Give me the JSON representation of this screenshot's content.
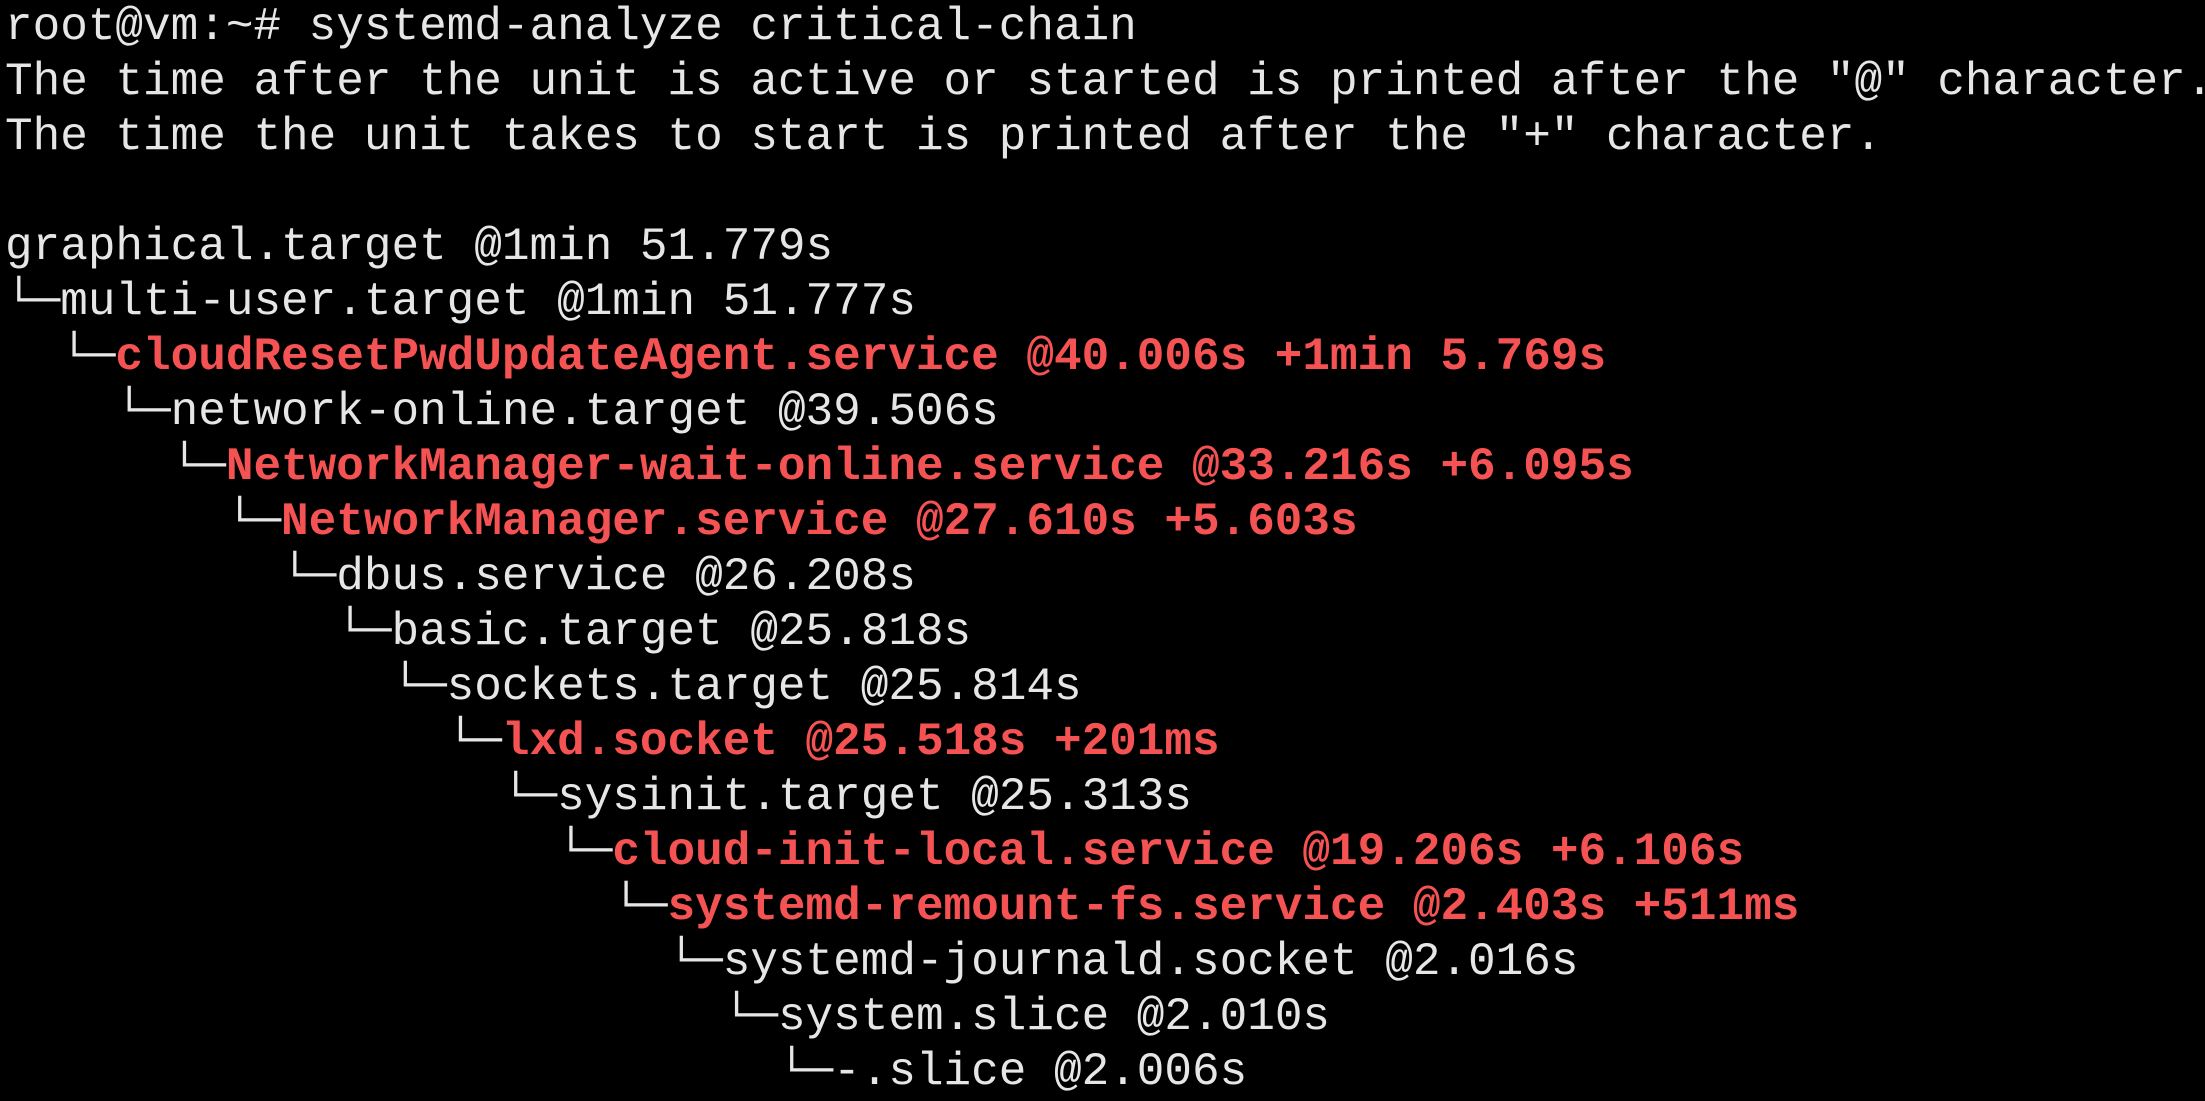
{
  "terminal": {
    "prompt": "root@vm:~# systemd-analyze critical-chain",
    "info_lines": [
      "The time after the unit is active or started is printed after the \"@\" character.",
      "The time the unit takes to start is printed after the \"+\" character."
    ],
    "chain": [
      {
        "prefix": "",
        "text": "graphical.target @1min 51.779s",
        "highlight": false
      },
      {
        "prefix": "└─",
        "text": "multi-user.target @1min 51.777s",
        "highlight": false
      },
      {
        "prefix": "  └─",
        "text": "cloudResetPwdUpdateAgent.service @40.006s +1min 5.769s",
        "highlight": true
      },
      {
        "prefix": "    └─",
        "text": "network-online.target @39.506s",
        "highlight": false
      },
      {
        "prefix": "      └─",
        "text": "NetworkManager-wait-online.service @33.216s +6.095s",
        "highlight": true
      },
      {
        "prefix": "        └─",
        "text": "NetworkManager.service @27.610s +5.603s",
        "highlight": true
      },
      {
        "prefix": "          └─",
        "text": "dbus.service @26.208s",
        "highlight": false
      },
      {
        "prefix": "            └─",
        "text": "basic.target @25.818s",
        "highlight": false
      },
      {
        "prefix": "              └─",
        "text": "sockets.target @25.814s",
        "highlight": false
      },
      {
        "prefix": "                └─",
        "text": "lxd.socket @25.518s +201ms",
        "highlight": true
      },
      {
        "prefix": "                  └─",
        "text": "sysinit.target @25.313s",
        "highlight": false
      },
      {
        "prefix": "                    └─",
        "text": "cloud-init-local.service @19.206s +6.106s",
        "highlight": true
      },
      {
        "prefix": "                      └─",
        "text": "systemd-remount-fs.service @2.403s +511ms",
        "highlight": true
      },
      {
        "prefix": "                        └─",
        "text": "systemd-journald.socket @2.016s",
        "highlight": false
      },
      {
        "prefix": "                          └─",
        "text": "system.slice @2.010s",
        "highlight": false
      },
      {
        "prefix": "                            └─",
        "text": "-.slice @2.006s",
        "highlight": false
      }
    ],
    "colors": {
      "background": "#000000",
      "text": "#e6e6e6",
      "highlight": "#f55353"
    }
  }
}
